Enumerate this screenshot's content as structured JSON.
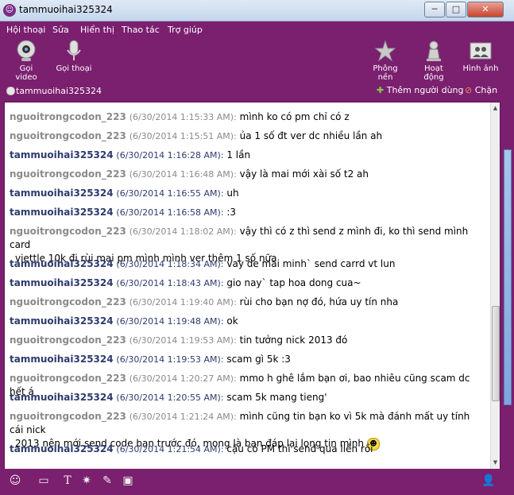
{
  "window": {
    "title": "tammuoihai325324",
    "minimize": "─",
    "maximize": "□",
    "close": "✕"
  },
  "menu": [
    "Hội thoại",
    "Sửa",
    "Hiển thị",
    "Thao tác",
    "Trợ giúp"
  ],
  "toolbar": {
    "video": "Gọi video",
    "voice": "Gọi thoại",
    "theme": "Phông nền",
    "activity": "Hoạt động",
    "avatar": "Hình ảnh"
  },
  "status": {
    "username": "tammuoihai325324",
    "add_user": "Thêm người dùng",
    "block": "Chặn"
  },
  "messages": [
    {
      "sender": "nguoitrongcodon_223",
      "me": false,
      "time": "(6/30/2014 1:15:33 AM):",
      "text": "mình ko có pm chỉ có z"
    },
    {
      "sender": "nguoitrongcodon_223",
      "me": false,
      "time": "(6/30/2014 1:15:51 AM):",
      "text": "ủa 1 số đt ver dc nhiều lần ah"
    },
    {
      "sender": "tammuoihai325324",
      "me": true,
      "time": "(6/30/2014 1:16:28 AM):",
      "text": "1 lần"
    },
    {
      "sender": "nguoitrongcodon_223",
      "me": false,
      "time": "(6/30/2014 1:16:48 AM):",
      "text": "vậy là mai mới xài số t2 ah"
    },
    {
      "sender": "tammuoihai325324",
      "me": true,
      "time": "(6/30/2014 1:16:55 AM):",
      "text": "uh"
    },
    {
      "sender": "tammuoihai325324",
      "me": true,
      "time": "(6/30/2014 1:16:58 AM):",
      "text": ":3"
    },
    {
      "sender": "nguoitrongcodon_223",
      "me": false,
      "time": "(6/30/2014 1:18:02 AM):",
      "text": "vậy thì có z thì send z mình đi, ko thì send mình card",
      "text2": "viettle 10k đi rùi mai pm mình mình ver thêm 1 số nữa"
    },
    {
      "sender": "tammuoihai325324",
      "me": true,
      "time": "(6/30/2014 1:18:34 AM):",
      "text": "vay de mai minh` send carrd vt lun"
    },
    {
      "sender": "tammuoihai325324",
      "me": true,
      "time": "(6/30/2014 1:18:43 AM):",
      "text": "gio nay` tap hoa dong cua~"
    },
    {
      "sender": "nguoitrongcodon_223",
      "me": false,
      "time": "(6/30/2014 1:19:40 AM):",
      "text": "rùi cho bạn nợ đó, hứa uy tín nha"
    },
    {
      "sender": "tammuoihai325324",
      "me": true,
      "time": "(6/30/2014 1:19:48 AM):",
      "text": "ok"
    },
    {
      "sender": "nguoitrongcodon_223",
      "me": false,
      "time": "(6/30/2014 1:19:53 AM):",
      "text": "tin tưởng nick 2013 đó"
    },
    {
      "sender": "tammuoihai325324",
      "me": true,
      "time": "(6/30/2014 1:19:53 AM):",
      "text": "scam gì 5k :3"
    },
    {
      "sender": "nguoitrongcodon_223",
      "me": false,
      "time": "(6/30/2014 1:20:27 AM):",
      "text": "mmo h ghê lắm bạn ơi, bao nhiêu cũng scam dc hết á"
    },
    {
      "sender": "tammuoihai325324",
      "me": true,
      "time": "(6/30/2014 1:20:55 AM):",
      "text": "scam 5k mang tieng'"
    },
    {
      "sender": "nguoitrongcodon_223",
      "me": false,
      "time": "(6/30/2014 1:21:24 AM):",
      "text": "mình cũng tin bạn ko vì 5k mà đánh mất uy tính cái nick",
      "text2": "2013 nên mới send code bạn trước đó, mong là bạn đáp lại long tin mình"
    },
    {
      "sender": "tammuoihai325324",
      "me": true,
      "time": "(6/30/2014 1:21:54 AM):",
      "text": "cậu có PM thì send qua liền rồi"
    }
  ]
}
